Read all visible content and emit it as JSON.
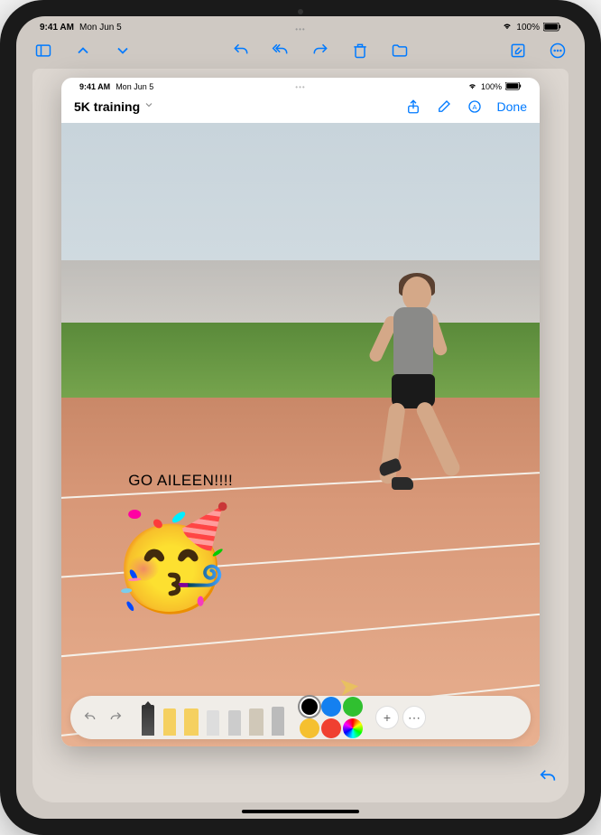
{
  "status": {
    "time": "9:41 AM",
    "date": "Mon Jun 5",
    "battery_pct": "100%"
  },
  "inner": {
    "title": "5K training",
    "done_label": "Done"
  },
  "annotation": {
    "text": "GO AILEEN!!!!",
    "emoji": "🥳"
  },
  "colors": {
    "black": "#000000",
    "blue": "#1480f0",
    "green": "#30c030",
    "yellow": "#f5c030",
    "red": "#f04030"
  }
}
